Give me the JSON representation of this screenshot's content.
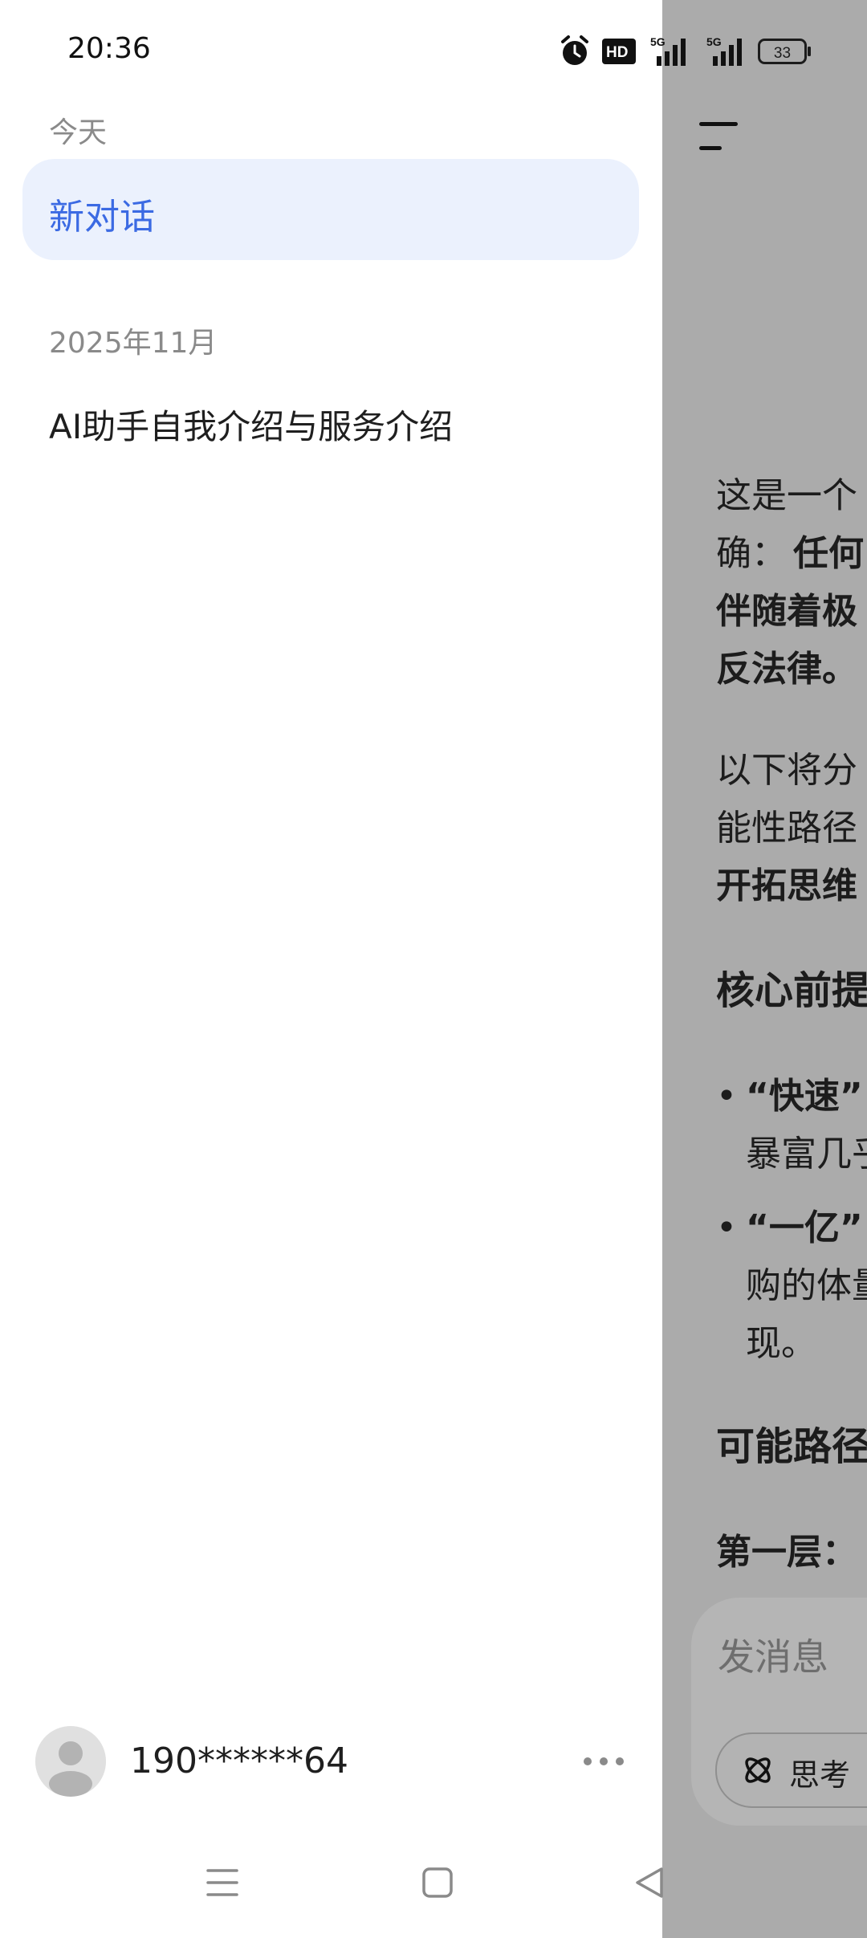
{
  "status_bar": {
    "time": "20:36",
    "icons": [
      "alarm-icon",
      "hd-voice-icon",
      "5g-signal-icon",
      "5g-signal-icon",
      "battery-icon"
    ],
    "battery_level": "33"
  },
  "drawer": {
    "today_label": "今天",
    "active_chat": "新对话",
    "month_label": "2025年11月",
    "chats": [
      "AI助手自我介绍与服务介绍"
    ],
    "user": {
      "phone": "190******64"
    }
  },
  "background_chat": {
    "lines": [
      "这是一个",
      "确：",
      "任何",
      "伴随着极",
      "反法律。",
      "以下将分",
      "能性路径",
      "开拓思维",
      "核心前提",
      "“快速”",
      "暴富几乎",
      "“一亿”",
      "购的体量",
      "现。",
      "可能路径",
      "第一层："
    ],
    "input_placeholder": "发消息",
    "think_label": "思考"
  },
  "colors": {
    "accent": "#3b6ae3",
    "active_bg": "#ebf1fd",
    "overlay": "#ababab"
  }
}
